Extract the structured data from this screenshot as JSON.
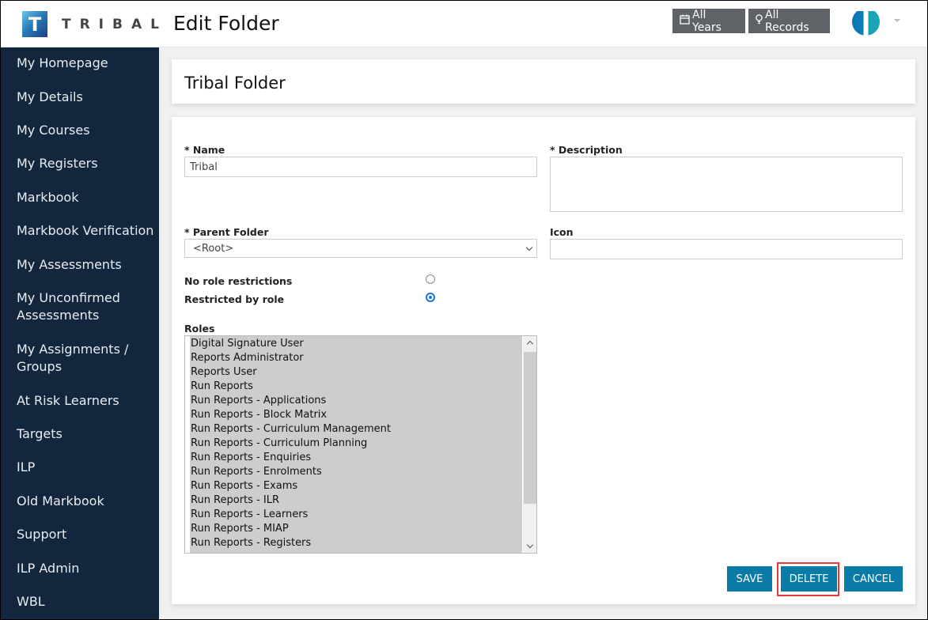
{
  "header": {
    "logo_letter": "T",
    "logo_text": "TRIBAL",
    "page_title": "Edit Folder",
    "years_button": {
      "icon": "calendar-icon",
      "icon_glyph": "🗓",
      "label": "All Years"
    },
    "records_button": {
      "icon": "lightbulb-icon",
      "icon_glyph": "💡",
      "label": "All Records"
    },
    "user_menu": {
      "avatar": "tribal-avatar",
      "caret": "chevron-down-icon"
    }
  },
  "sidebar": {
    "items": [
      {
        "label": "My Homepage"
      },
      {
        "label": "My Details"
      },
      {
        "label": "My Courses"
      },
      {
        "label": "My Registers"
      },
      {
        "label": "Markbook"
      },
      {
        "label": "Markbook Verification"
      },
      {
        "label": "My Assessments"
      },
      {
        "label": "My Unconfirmed\nAssessments"
      },
      {
        "label": "My Assignments /\nGroups"
      },
      {
        "label": "At Risk Learners"
      },
      {
        "label": "Targets"
      },
      {
        "label": "ILP"
      },
      {
        "label": "Old Markbook"
      },
      {
        "label": "Support"
      },
      {
        "label": "ILP Admin"
      },
      {
        "label": "WBL"
      }
    ]
  },
  "folder": {
    "title": "Tribal Folder"
  },
  "form": {
    "name": {
      "label": "* Name",
      "value": "Tribal"
    },
    "description": {
      "label": "* Description",
      "value": ""
    },
    "parent_folder": {
      "label": "* Parent Folder",
      "value": "<Root>"
    },
    "icon": {
      "label": "Icon",
      "value": ""
    },
    "restrictions": {
      "options": [
        {
          "label": "No role restrictions",
          "selected": false
        },
        {
          "label": "Restricted by role",
          "selected": true
        }
      ]
    },
    "roles": {
      "label": "Roles",
      "options": [
        "Digital Signature User",
        "Reports Administrator",
        "Reports User",
        "Run Reports",
        "Run Reports - Applications",
        "Run Reports - Block Matrix",
        "Run Reports - Curriculum Management",
        "Run Reports - Curriculum Planning",
        "Run Reports - Enquiries",
        "Run Reports - Enrolments",
        "Run Reports - Exams",
        "Run Reports - ILR",
        "Run Reports - Learners",
        "Run Reports - MIAP",
        "Run Reports - Registers"
      ]
    },
    "buttons": {
      "save": "SAVE",
      "delete": "DELETE",
      "cancel": "CANCEL"
    }
  },
  "colors": {
    "sidebar_bg": "#12263d",
    "primary_button": "#0a7ba6",
    "header_button": "#5f6266",
    "highlight_outline": "#e8393c",
    "radio_selected": "#1a73e8"
  }
}
